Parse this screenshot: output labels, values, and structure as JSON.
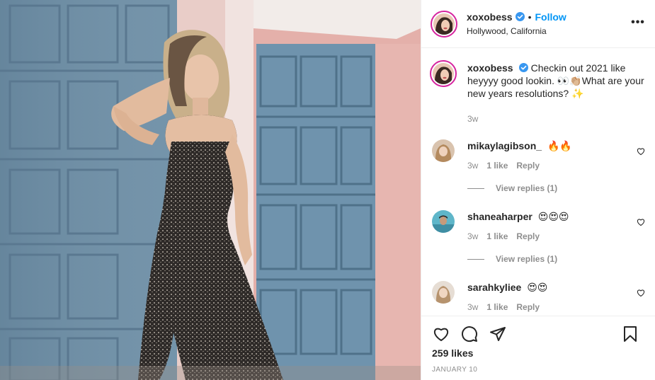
{
  "post": {
    "username": "xoxobess",
    "follow_label": "Follow",
    "separator": "•",
    "location": "Hollywood, California",
    "more_label": "•••"
  },
  "caption": {
    "username": "xoxobess",
    "text": "Checkin out 2021 like heyyyy good lookin. 👀👏🏼What are your new years resolutions? ✨",
    "time": "3w"
  },
  "comments": [
    {
      "username": "mikaylagibson_",
      "text": "🔥🔥",
      "time": "3w",
      "likes": "1 like",
      "reply": "Reply",
      "view_replies": "View replies (1)"
    },
    {
      "username": "shaneaharper",
      "text": "😍😍😍",
      "time": "3w",
      "likes": "1 like",
      "reply": "Reply",
      "view_replies": "View replies (1)"
    },
    {
      "username": "sarahkyliee",
      "text": "😍😍",
      "time": "3w",
      "likes": "1 like",
      "reply": "Reply"
    }
  ],
  "footer": {
    "likes": "259 likes",
    "date": "January 10"
  },
  "colors": {
    "accent": "#0095f6",
    "ring": "#d6249f",
    "muted": "#8e8e8e",
    "text": "#262626",
    "verified": "#3897f0"
  },
  "icons": [
    "verified-badge-icon",
    "more-options-icon",
    "heart-icon",
    "comment-icon",
    "share-icon",
    "bookmark-icon"
  ]
}
